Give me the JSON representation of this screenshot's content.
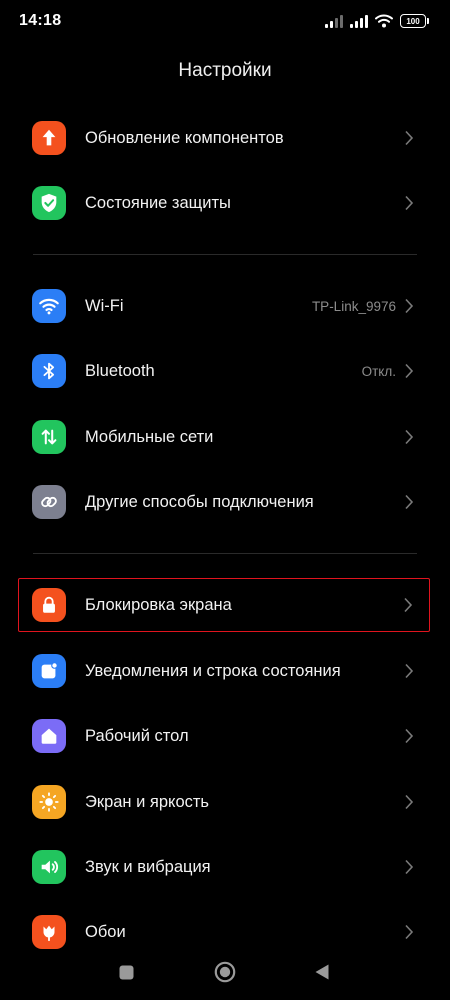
{
  "status_bar": {
    "time": "14:18",
    "battery": "100",
    "icons": [
      "signal-icon",
      "signal-icon",
      "wifi-icon",
      "battery-icon"
    ]
  },
  "header": {
    "title": "Настройки"
  },
  "groups": [
    {
      "items": [
        {
          "label": "Обновление компонентов",
          "icon": "arrow-up-icon",
          "color": "#f4511e"
        },
        {
          "label": "Состояние защиты",
          "icon": "shield-check-icon",
          "color": "#22c55e"
        }
      ]
    },
    {
      "items": [
        {
          "label": "Wi-Fi",
          "value": "TP-Link_9976",
          "icon": "wifi-icon",
          "color": "#2b7ef6"
        },
        {
          "label": "Bluetooth",
          "value": "Откл.",
          "icon": "bluetooth-icon",
          "color": "#2b7ef6"
        },
        {
          "label": "Мобильные сети",
          "icon": "mobile-data-icon",
          "color": "#22c55e"
        },
        {
          "label": "Другие способы подключения",
          "icon": "link-icon",
          "color": "#7d8090"
        }
      ]
    },
    {
      "items": [
        {
          "label": "Блокировка экрана",
          "icon": "lock-icon",
          "color": "#f4511e"
        },
        {
          "label": "Уведомления и строка состояния",
          "icon": "notification-icon",
          "color": "#2b7ef6"
        },
        {
          "label": "Рабочий стол",
          "icon": "home-icon",
          "color": "#7b6cf6"
        },
        {
          "label": "Экран и яркость",
          "icon": "sun-icon",
          "color": "#f5a623"
        },
        {
          "label": "Звук и вибрация",
          "icon": "speaker-icon",
          "color": "#22c55e"
        },
        {
          "label": "Обои",
          "icon": "tulip-icon",
          "color": "#f4511e"
        }
      ]
    }
  ],
  "nav_bar": {
    "icons": [
      "recents-icon",
      "home-circle-icon",
      "back-icon"
    ]
  },
  "colors": {
    "background": "#000000",
    "highlight": "#e0141e",
    "secondary_text": "#8c8c8c"
  }
}
